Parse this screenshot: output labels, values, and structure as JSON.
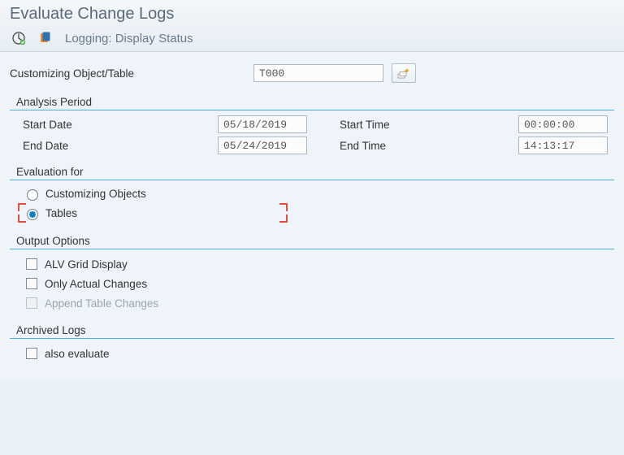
{
  "header": {
    "title": "Evaluate Change Logs",
    "subtitle": "Logging: Display Status"
  },
  "fields": {
    "customizing_object_label": "Customizing Object/Table",
    "customizing_object_value": "T000"
  },
  "groups": {
    "analysis_period": {
      "title": "Analysis Period",
      "start_date_label": "Start Date",
      "start_date_value": "05/18/2019",
      "end_date_label": "End Date",
      "end_date_value": "05/24/2019",
      "start_time_label": "Start Time",
      "start_time_value": "00:00:00",
      "end_time_label": "End Time",
      "end_time_value": "14:13:17"
    },
    "evaluation_for": {
      "title": "Evaluation for",
      "opt_customizing": "Customizing Objects",
      "opt_tables": "Tables"
    },
    "output_options": {
      "title": "Output Options",
      "alv_grid": "ALV Grid Display",
      "only_actual": "Only Actual Changes",
      "append_table": "Append Table Changes"
    },
    "archived_logs": {
      "title": "Archived Logs",
      "also_evaluate": "also evaluate"
    }
  }
}
